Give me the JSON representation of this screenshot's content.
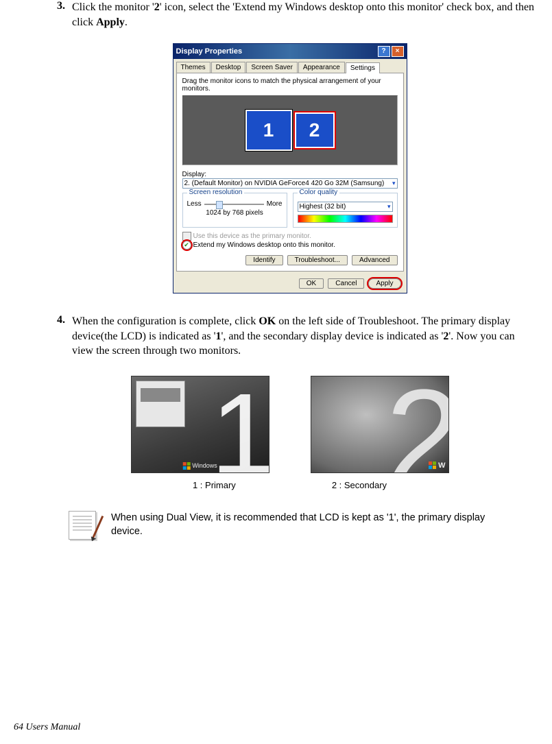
{
  "steps": {
    "s3": {
      "num": "3.",
      "p1a": "Click the monitor '",
      "p1b": "2",
      "p1c": "' icon, select the 'Extend my Windows desktop onto this monitor' check box, and then click ",
      "p1d": "Apply",
      "p1e": "."
    },
    "s4": {
      "num": "4.",
      "p1a": "When the configuration is complete, click ",
      "p1b": "OK",
      "p1c": " on the left side of Troubleshoot. The primary display device(the LCD) is indicated as '",
      "p1d": "1",
      "p1e": "', and the secondary display device is indicated as '",
      "p1f": "2",
      "p1g": "'. Now you can view the screen through two monitors."
    }
  },
  "dp": {
    "title": "Display Properties",
    "tabs": {
      "t1": "Themes",
      "t2": "Desktop",
      "t3": "Screen Saver",
      "t4": "Appearance",
      "t5": "Settings"
    },
    "instr": "Drag the monitor icons to match the physical arrangement of your monitors.",
    "mon1": "1",
    "mon2": "2",
    "display_label": "Display:",
    "display_value": "2. (Default Monitor) on NVIDIA GeForce4 420 Go 32M (Samsung)",
    "sr_title": "Screen resolution",
    "less": "Less",
    "more": "More",
    "res": "1024 by 768 pixels",
    "cq_title": "Color quality",
    "cq_value": "Highest (32 bit)",
    "chk1": "Use this device as the primary monitor.",
    "chk2": "Extend my Windows desktop onto this monitor.",
    "identify": "Identify",
    "troubleshoot": "Troubleshoot...",
    "advanced": "Advanced",
    "ok": "OK",
    "cancel": "Cancel",
    "apply": "Apply"
  },
  "dual": {
    "big1": "1",
    "big2": "2",
    "winlabel": "Windows",
    "cap1": "1 : Primary",
    "cap2": "2 : Secondary"
  },
  "note": {
    "text": "When using Dual View, it is recommended that LCD is kept as '1', the primary display device."
  },
  "footer": "64  Users Manual"
}
